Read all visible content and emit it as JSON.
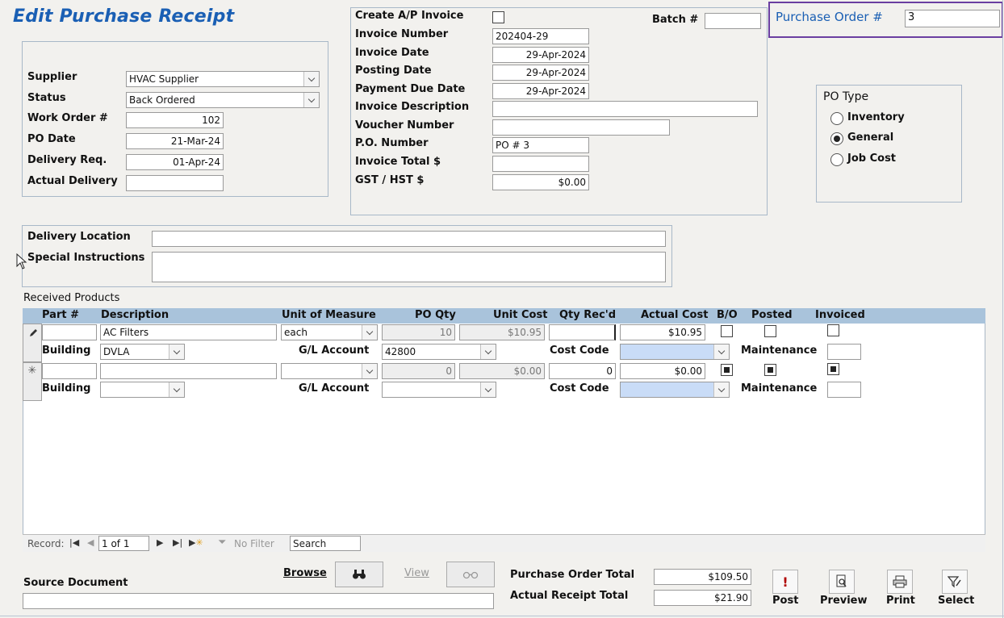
{
  "window": {
    "title": "Edit Purchase Receipt"
  },
  "header": {
    "batch_label": "Batch #",
    "batch_value": "",
    "po_number_label": "Purchase Order #",
    "po_number_value": "3"
  },
  "supplier_section": {
    "supplier_label": "Supplier",
    "supplier_value": "HVAC Supplier",
    "status_label": "Status",
    "status_value": "Back Ordered",
    "work_order_label": "Work Order #",
    "work_order_value": "102",
    "po_date_label": "PO Date",
    "po_date_value": "21-Mar-24",
    "delivery_req_label": "Delivery Req.",
    "delivery_req_value": "01-Apr-24",
    "actual_delivery_label": "Actual Delivery",
    "actual_delivery_value": ""
  },
  "invoice_section": {
    "create_ap_label": "Create A/P Invoice",
    "create_ap_checked": false,
    "invoice_number_label": "Invoice Number",
    "invoice_number_value": "202404-29",
    "invoice_date_label": "Invoice Date",
    "invoice_date_value": "29-Apr-2024",
    "posting_date_label": "Posting Date",
    "posting_date_value": "29-Apr-2024",
    "payment_due_label": "Payment Due Date",
    "payment_due_value": "29-Apr-2024",
    "invoice_desc_label": "Invoice Description",
    "invoice_desc_value": "",
    "voucher_label": "Voucher Number",
    "voucher_value": "",
    "po_ref_label": "P.O. Number",
    "po_ref_value": "PO # 3",
    "invoice_total_label": "Invoice Total $",
    "invoice_total_value": "",
    "gst_label": "GST / HST $",
    "gst_value": "$0.00"
  },
  "po_type": {
    "label": "PO Type",
    "options": [
      "Inventory",
      "General",
      "Job Cost"
    ],
    "selected": "General"
  },
  "delivery_section": {
    "location_label": "Delivery Location",
    "location_value": "",
    "instructions_label": "Special Instructions",
    "instructions_value": ""
  },
  "products": {
    "section_label": "Received Products",
    "columns": [
      "Part #",
      "Description",
      "Unit of Measure",
      "PO Qty",
      "Unit Cost",
      "Qty Rec'd",
      "Actual Cost",
      "B/O",
      "Posted",
      "Invoiced"
    ],
    "sub_labels": {
      "building": "Building",
      "gl_account": "G/L Account",
      "cost_code": "Cost Code",
      "maintenance": "Maintenance"
    },
    "rows": [
      {
        "part": "",
        "description": "AC Filters",
        "uom": "each",
        "po_qty": "10",
        "unit_cost": "$10.95",
        "qty_recd": "",
        "actual_cost": "$10.95",
        "bo": false,
        "posted": false,
        "invoiced": false,
        "building": "DVLA",
        "gl_account": "42800",
        "cost_code": "",
        "maintenance": ""
      },
      {
        "part": "",
        "description": "",
        "uom": "",
        "po_qty": "0",
        "unit_cost": "$0.00",
        "qty_recd": "0",
        "actual_cost": "$0.00",
        "bo": true,
        "posted": true,
        "invoiced": true,
        "building": "",
        "gl_account": "",
        "cost_code": "",
        "maintenance": ""
      }
    ]
  },
  "navigation": {
    "record_label": "Record:",
    "record_value": "1 of 1",
    "filter_label": "No Filter",
    "search_value": "Search"
  },
  "footer": {
    "source_doc_label": "Source Document",
    "source_doc_value": "",
    "browse_label": "Browse",
    "view_label": "View",
    "po_total_label": "Purchase Order Total",
    "po_total_value": "$109.50",
    "receipt_total_label": "Actual Receipt Total",
    "receipt_total_value": "$21.90",
    "post_label": "Post",
    "preview_label": "Preview",
    "print_label": "Print",
    "select_label": "Select"
  },
  "colors": {
    "accent": "#1a5fb4",
    "grid_header": "#a9c3db",
    "highlight_border": "#6a3ea1",
    "cost_code_bg": "#c9dcf7"
  }
}
